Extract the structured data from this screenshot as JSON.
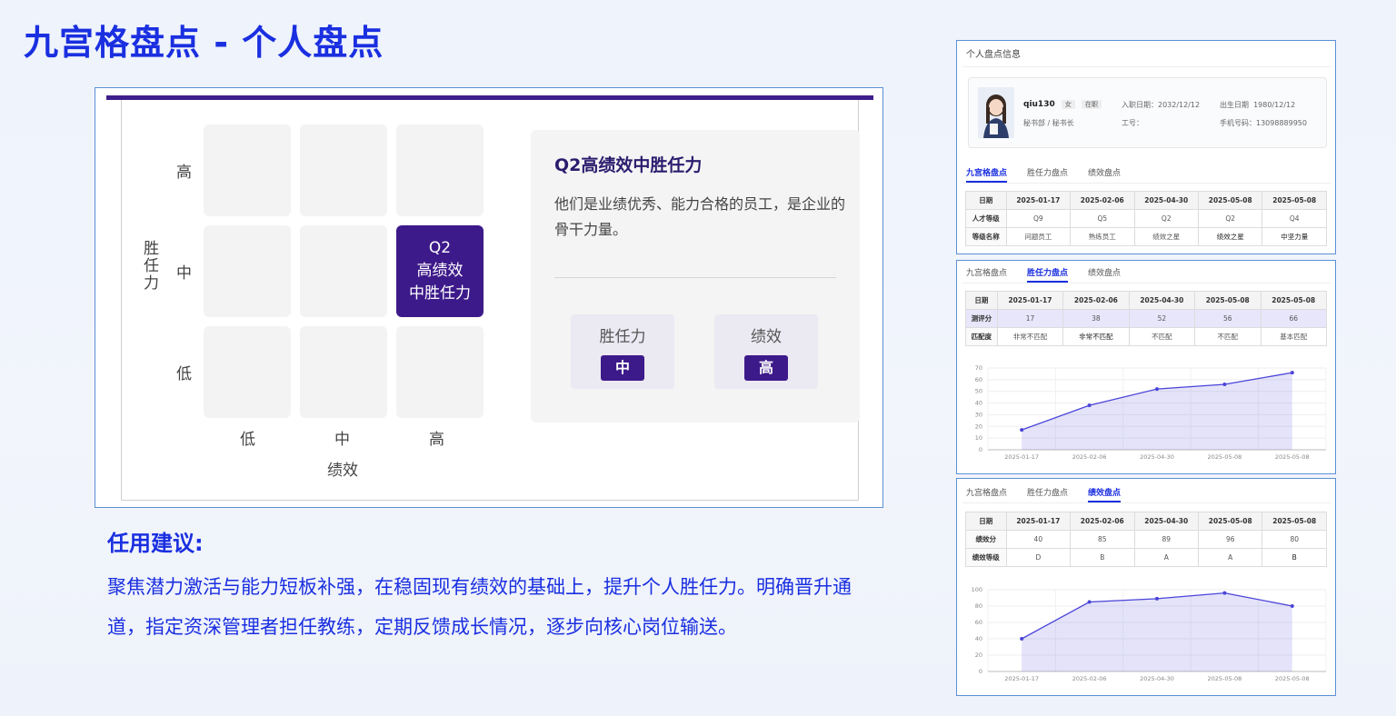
{
  "page": {
    "title": "九宫格盘点 - 个人盘点"
  },
  "nine_box": {
    "y_axis_title": [
      "胜",
      "任",
      "力"
    ],
    "y_levels": [
      "高",
      "中",
      "低"
    ],
    "x_levels": [
      "低",
      "中",
      "高"
    ],
    "x_axis_title": "绩效",
    "active_cell": {
      "code": "Q2",
      "line1": "高绩效",
      "line2": "中胜任力"
    },
    "detail": {
      "title": "Q2高绩效中胜任力",
      "description": "他们是业绩优秀、能力合格的员工，是企业的骨干力量。",
      "competency_label": "胜任力",
      "competency_value": "中",
      "performance_label": "绩效",
      "performance_value": "高"
    }
  },
  "advice": {
    "title": "任用建议:",
    "text": "聚焦潜力激活与能力短板补强，在稳固现有绩效的基础上，提升个人胜任力。明确晋升通道，指定资深管理者担任教练，定期反馈成长情况，逐步向核心岗位输送。"
  },
  "profile": {
    "header": "个人盘点信息",
    "name": "qiu130",
    "gender_tag": "女",
    "status_tag": "在职",
    "department": "秘书部 / 秘书长",
    "hire_date_label": "入职日期：",
    "hire_date": "2032/12/12",
    "emp_no_label": "工号：",
    "birth_label": "出生日期",
    "birth_date": "1980/12/12",
    "phone_label": "手机号码：",
    "phone": "13098889950"
  },
  "tabs": [
    "九宫格盘点",
    "胜任力盘点",
    "绩效盘点"
  ],
  "ninebox_table": {
    "header": [
      "日期",
      "2025-01-17",
      "2025-02-06",
      "2025-04-30",
      "2025-05-08",
      "2025-05-08"
    ],
    "rows": [
      [
        "人才等级",
        "Q9",
        "Q5",
        "Q2",
        "Q2",
        "Q4"
      ],
      [
        "等级名称",
        "问题员工",
        "熟练员工",
        "绩效之星",
        "绩效之星",
        "中坚力量"
      ]
    ]
  },
  "competency_table": {
    "header": [
      "日期",
      "2025-01-17",
      "2025-02-06",
      "2025-04-30",
      "2025-05-08",
      "2025-05-08"
    ],
    "rows": [
      [
        "测评分",
        "17",
        "38",
        "52",
        "56",
        "66"
      ],
      [
        "匹配度",
        "非常不匹配",
        "非常不匹配",
        "不匹配",
        "不匹配",
        "基本匹配"
      ]
    ]
  },
  "performance_table": {
    "header": [
      "日期",
      "2025-01-17",
      "2025-02-06",
      "2025-04-30",
      "2025-05-08",
      "2025-05-08"
    ],
    "rows": [
      [
        "绩效分",
        "40",
        "85",
        "89",
        "96",
        "80"
      ],
      [
        "绩效等级",
        "D",
        "B",
        "A",
        "A",
        "B"
      ]
    ]
  },
  "chart_data": [
    {
      "type": "area",
      "categories": [
        "2025-01-17",
        "2025-02-06",
        "2025-04-30",
        "2025-05-08",
        "2025-05-08"
      ],
      "values": [
        17,
        38,
        52,
        56,
        66
      ],
      "ylim": [
        0,
        70
      ],
      "yticks": [
        0,
        10,
        20,
        30,
        40,
        50,
        60,
        70
      ],
      "grid": true,
      "color": "#4a44d8"
    },
    {
      "type": "area",
      "categories": [
        "2025-01-17",
        "2025-02-06",
        "2025-04-30",
        "2025-05-08",
        "2025-05-08"
      ],
      "values": [
        40,
        85,
        89,
        96,
        80
      ],
      "ylim": [
        0,
        100
      ],
      "yticks": [
        0,
        20,
        40,
        60,
        80,
        100
      ],
      "grid": true,
      "color": "#4a44d8"
    }
  ],
  "colors": {
    "accent": "#1a2fe0",
    "purple": "#3d1a8a",
    "frame": "#5b8fd6"
  }
}
